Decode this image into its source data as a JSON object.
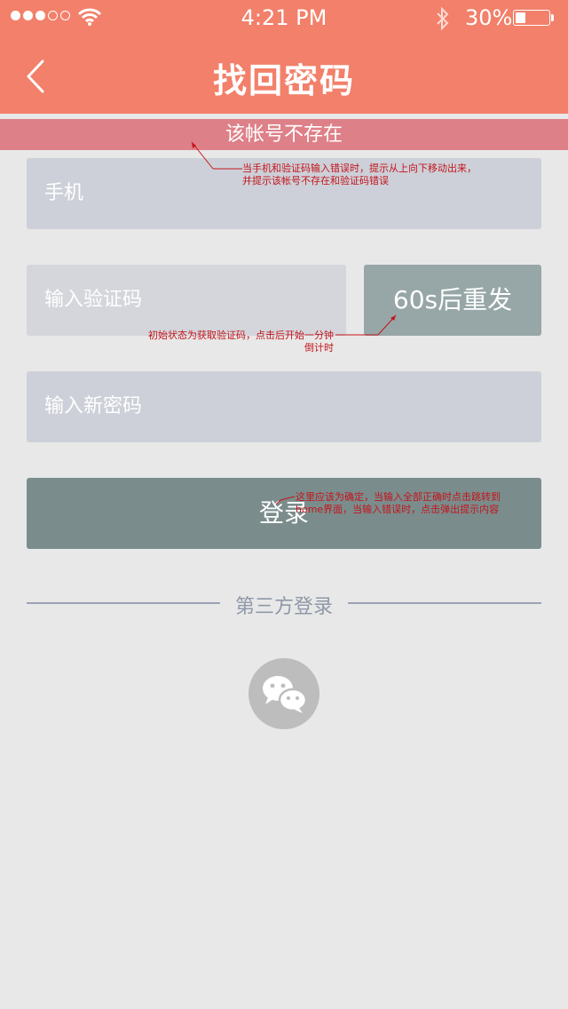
{
  "status_bar": {
    "time": "4:21 PM",
    "battery_percent": "30%",
    "battery_level": 0.3,
    "signal_bars_filled": 3,
    "signal_bars_total": 5,
    "icons": [
      "wifi-icon",
      "bluetooth-icon",
      "battery-icon"
    ]
  },
  "navbar": {
    "title": "找回密码",
    "back_icon": "chevron-left-icon"
  },
  "error_banner": {
    "text": "该帐号不存在"
  },
  "form": {
    "phone_placeholder": "手机",
    "code_placeholder": "输入验证码",
    "resend_label": "60s后重发",
    "password_placeholder": "输入新密码",
    "submit_label": "登录"
  },
  "third_party": {
    "label": "第三方登录",
    "wechat_icon": "wechat-icon"
  },
  "annotations": {
    "note_error": "当手机和验证码输入错误时，提示从上向下移动出来，并提示该帐号不存在和验证码错误",
    "note_code": "初始状态为获取验证码，点击后开始一分钟倒计时",
    "note_submit": "这里应该为确定，当输入全部正确时点击跳转到home界面，当输入错误时，点击弹出提示内容"
  },
  "colors": {
    "header": "#f2806a",
    "error_banner": "#de8088",
    "input": "#cdd0d8",
    "resend_button": "#97a6a6",
    "submit_button": "#7a8d8c",
    "annotation": "#c4141c"
  }
}
